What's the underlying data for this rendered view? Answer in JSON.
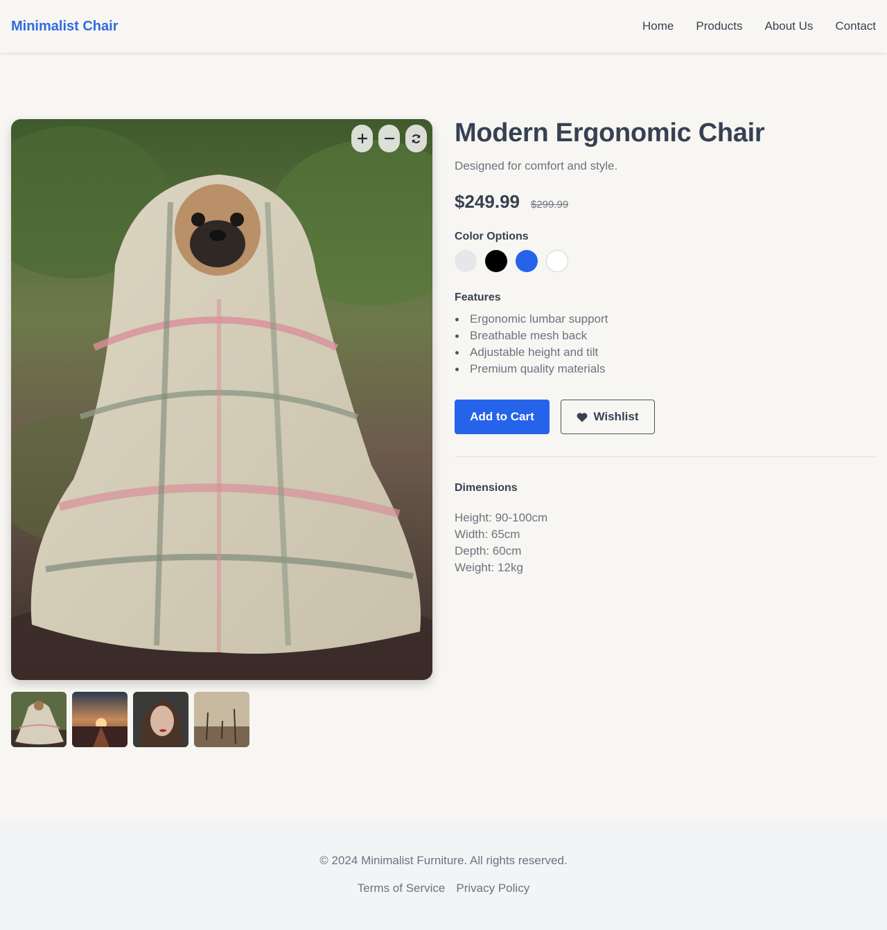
{
  "header": {
    "brand": "Minimalist Chair",
    "nav": [
      "Home",
      "Products",
      "About Us",
      "Contact"
    ]
  },
  "gallery": {
    "controls": [
      "zoom-in-icon",
      "zoom-out-icon",
      "refresh-icon"
    ],
    "thumbnails": [
      "pug-in-blanket",
      "sunset-road",
      "woman-portrait",
      "misty-dead-trees"
    ]
  },
  "product": {
    "title": "Modern Ergonomic Chair",
    "subtitle": "Designed for comfort and style.",
    "price": "$249.99",
    "old_price": "$299.99",
    "color_label": "Color Options",
    "colors": [
      "#e5e7eb",
      "#000000",
      "#2563eb",
      "#ffffff"
    ],
    "features_label": "Features",
    "features": [
      "Ergonomic lumbar support",
      "Breathable mesh back",
      "Adjustable height and tilt",
      "Premium quality materials"
    ],
    "add_to_cart": "Add to Cart",
    "wishlist": "Wishlist",
    "dimensions_label": "Dimensions",
    "dimensions": [
      "Height: 90-100cm",
      "Width: 65cm",
      "Depth: 60cm",
      "Weight: 12kg"
    ]
  },
  "footer": {
    "copyright": "© 2024 Minimalist Furniture. All rights reserved.",
    "links": [
      "Terms of Service",
      "Privacy Policy"
    ]
  },
  "theme": {
    "brand_color": "#2f6ae0",
    "accent": "#2563eb",
    "background": "#f8f6f2"
  }
}
